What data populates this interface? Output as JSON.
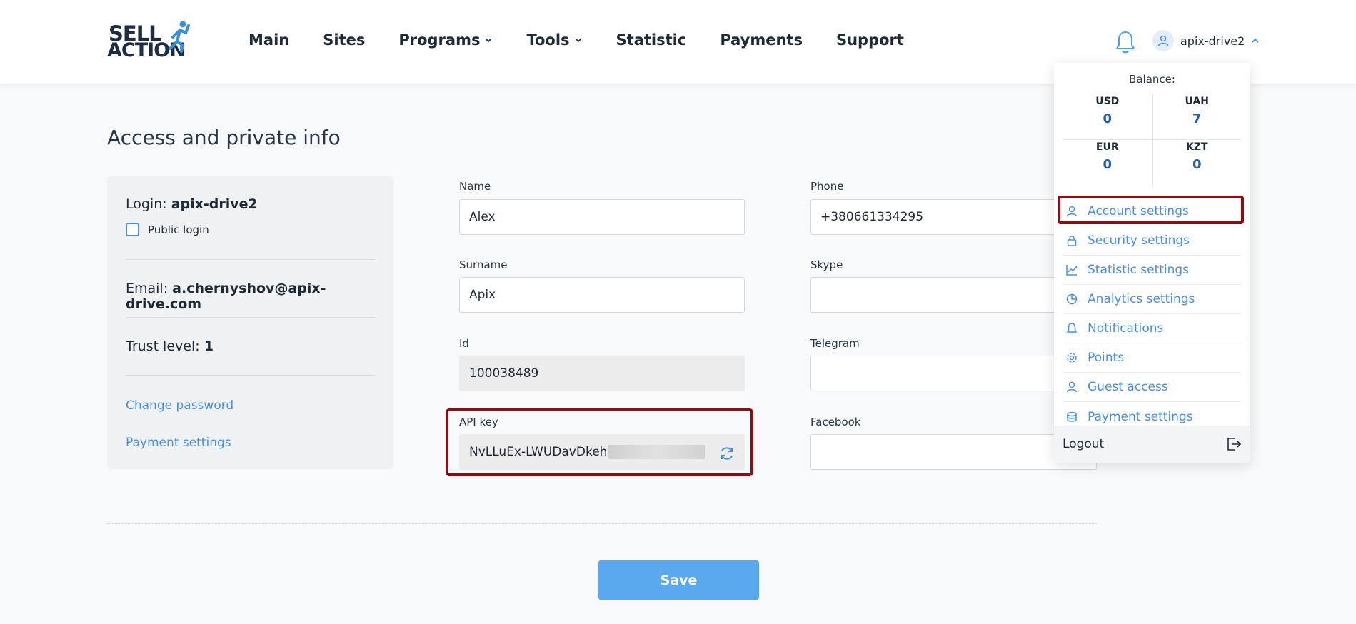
{
  "logo": {
    "line1": "SELL",
    "line2": "ACTION"
  },
  "nav": [
    "Main",
    "Sites",
    "Programs",
    "Tools",
    "Statistic",
    "Payments",
    "Support"
  ],
  "header": {
    "username": "apix-drive2"
  },
  "page": {
    "title": "Access and private info"
  },
  "account": {
    "login_label": "Login:",
    "login_value": "apix-drive2",
    "public_login_label": "Public login",
    "email_label": "Email:",
    "email_value": "a.chernyshov@apix-drive.com",
    "trust_label": "Trust level:",
    "trust_value": "1",
    "change_password": "Change password",
    "payment_settings": "Payment settings"
  },
  "form": {
    "name_label": "Name",
    "name_value": "Alex",
    "surname_label": "Surname",
    "surname_value": "Apix",
    "id_label": "Id",
    "id_value": "100038489",
    "api_label": "API key",
    "api_value": "NvLLuEx-LWUDavDkeh",
    "phone_label": "Phone",
    "phone_value": "+380661334295",
    "skype_label": "Skype",
    "skype_value": "",
    "telegram_label": "Telegram",
    "telegram_value": "",
    "facebook_label": "Facebook",
    "facebook_value": ""
  },
  "save_label": "Save",
  "dropdown": {
    "balance_title": "Balance:",
    "balances": [
      {
        "currency": "USD",
        "value": "0"
      },
      {
        "currency": "UAH",
        "value": "7"
      },
      {
        "currency": "EUR",
        "value": "0"
      },
      {
        "currency": "KZT",
        "value": "0"
      }
    ],
    "items": [
      {
        "label": "Account settings",
        "icon": "user-icon"
      },
      {
        "label": "Security settings",
        "icon": "lock-icon"
      },
      {
        "label": "Statistic settings",
        "icon": "chart-line-icon"
      },
      {
        "label": "Analytics settings",
        "icon": "pie-chart-icon"
      },
      {
        "label": "Notifications",
        "icon": "bell-icon"
      },
      {
        "label": "Points",
        "icon": "gear-icon"
      },
      {
        "label": "Guest access",
        "icon": "user-icon"
      },
      {
        "label": "Payment settings",
        "icon": "coins-icon"
      }
    ],
    "logout_label": "Logout"
  },
  "colors": {
    "accent": "#4a90e2",
    "highlight": "#8b0e13",
    "save": "#5aa8ee"
  }
}
